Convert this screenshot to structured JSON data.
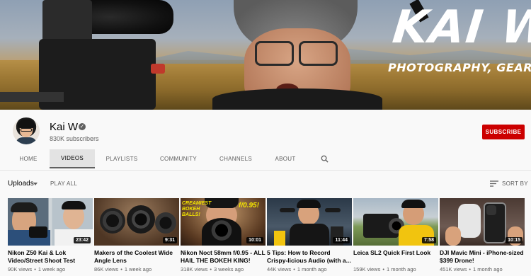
{
  "banner": {
    "name": "KAI W",
    "tagline": "PHOTOGRAPHY, GEAR, VLOG"
  },
  "channel": {
    "name": "Kai W",
    "subscribers": "830K subscribers",
    "subscribe_label": "SUBSCRIBE"
  },
  "tabs": [
    {
      "label": "HOME"
    },
    {
      "label": "VIDEOS"
    },
    {
      "label": "PLAYLISTS"
    },
    {
      "label": "COMMUNITY"
    },
    {
      "label": "CHANNELS"
    },
    {
      "label": "ABOUT"
    }
  ],
  "uploads": {
    "label": "Uploads",
    "play_all": "PLAY ALL",
    "sort_by": "SORT BY"
  },
  "videos": [
    {
      "title": "Nikon Z50 Kai & Lok Video/Street Shoot Test",
      "views": "90K views",
      "age": "1 week ago",
      "duration": "23:42"
    },
    {
      "title": "Makers of the Coolest Wide Angle Lens",
      "views": "86K views",
      "age": "1 week ago",
      "duration": "9:31"
    },
    {
      "title": "Nikon Noct 58mm f/0.95 - ALL HAIL THE BOKEH KING!",
      "views": "318K views",
      "age": "3 weeks ago",
      "duration": "10:01",
      "overlay_left": "CREAMIEST BOKEH BALLS!",
      "overlay_right": "f/0.95!"
    },
    {
      "title": "5 Tips: How to Record Crispy-licious Audio (with a...",
      "views": "44K views",
      "age": "1 month ago",
      "duration": "11:44"
    },
    {
      "title": "Leica SL2 Quick First Look",
      "views": "159K views",
      "age": "1 month ago",
      "duration": "7:58"
    },
    {
      "title": "DJI Mavic Mini - iPhone-sized $399 Drone!",
      "views": "451K views",
      "age": "1 month ago",
      "duration": "10:15"
    }
  ],
  "colors": {
    "subscribe": "#cc0000",
    "background": "#f9f9f9"
  }
}
